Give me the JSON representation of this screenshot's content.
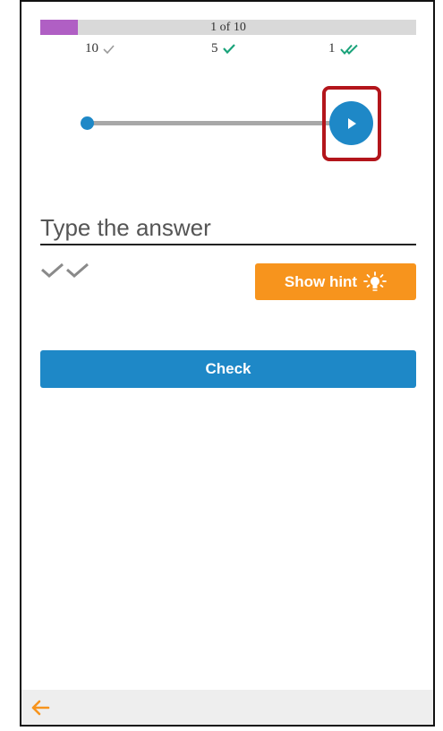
{
  "progress": {
    "label": "1 of 10",
    "fraction": 0.1,
    "fill_color": "#b05fc4"
  },
  "stats": [
    {
      "value": "10",
      "icon": "check-icon",
      "color": "#9a9a9a"
    },
    {
      "value": "5",
      "icon": "check-icon",
      "color": "#1aa37a"
    },
    {
      "value": "1",
      "icon": "double-check-icon",
      "color": "#1aa37a"
    }
  ],
  "audio": {
    "position": 0,
    "play_icon": "play-icon",
    "accent": "#1e88c7",
    "highlight_color": "#b3151b"
  },
  "answer": {
    "placeholder": "Type the answer",
    "value": ""
  },
  "hint": {
    "label": "Show hint",
    "icon": "lightbulb-icon",
    "color": "#f7941d"
  },
  "check": {
    "label": "Check",
    "color": "#1e88c7"
  },
  "footer": {
    "back_icon": "arrow-left-icon"
  }
}
